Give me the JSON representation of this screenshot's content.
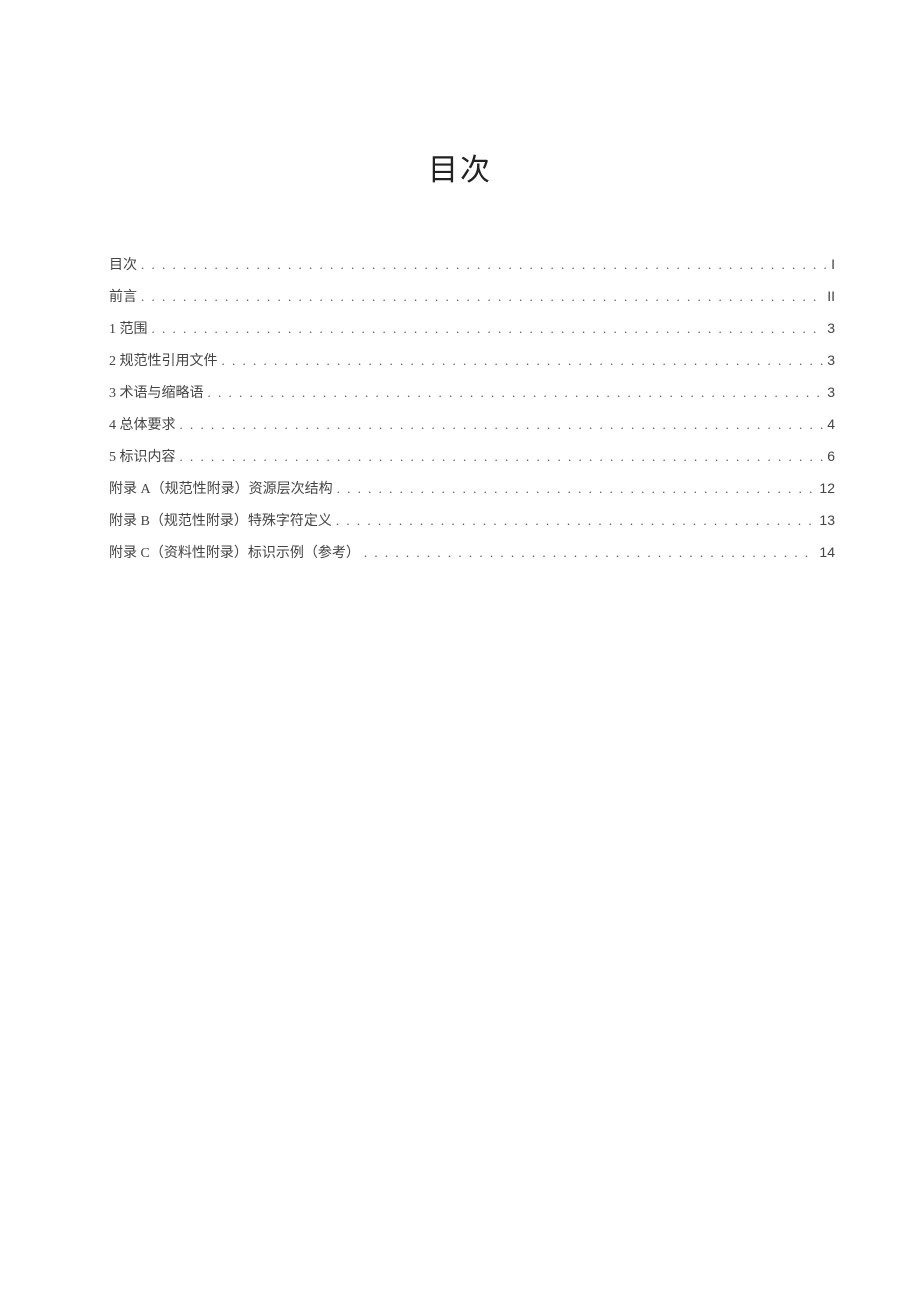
{
  "title": "目次",
  "toc": [
    {
      "label": "目次",
      "page": "I"
    },
    {
      "label": "前言",
      "page": "II"
    },
    {
      "label": "1 范围",
      "page": "3"
    },
    {
      "label": "2 规范性引用文件",
      "page": "3"
    },
    {
      "label": "3 术语与缩略语",
      "page": "3"
    },
    {
      "label": "4 总体要求",
      "page": "4"
    },
    {
      "label": "5 标识内容",
      "page": "6"
    },
    {
      "label": "附录 A（规范性附录）资源层次结构",
      "page": "12"
    },
    {
      "label": "附录 B（规范性附录）特殊字符定义",
      "page": "13"
    },
    {
      "label": "附录 C（资料性附录）标识示例（参考）",
      "page": "14"
    }
  ]
}
